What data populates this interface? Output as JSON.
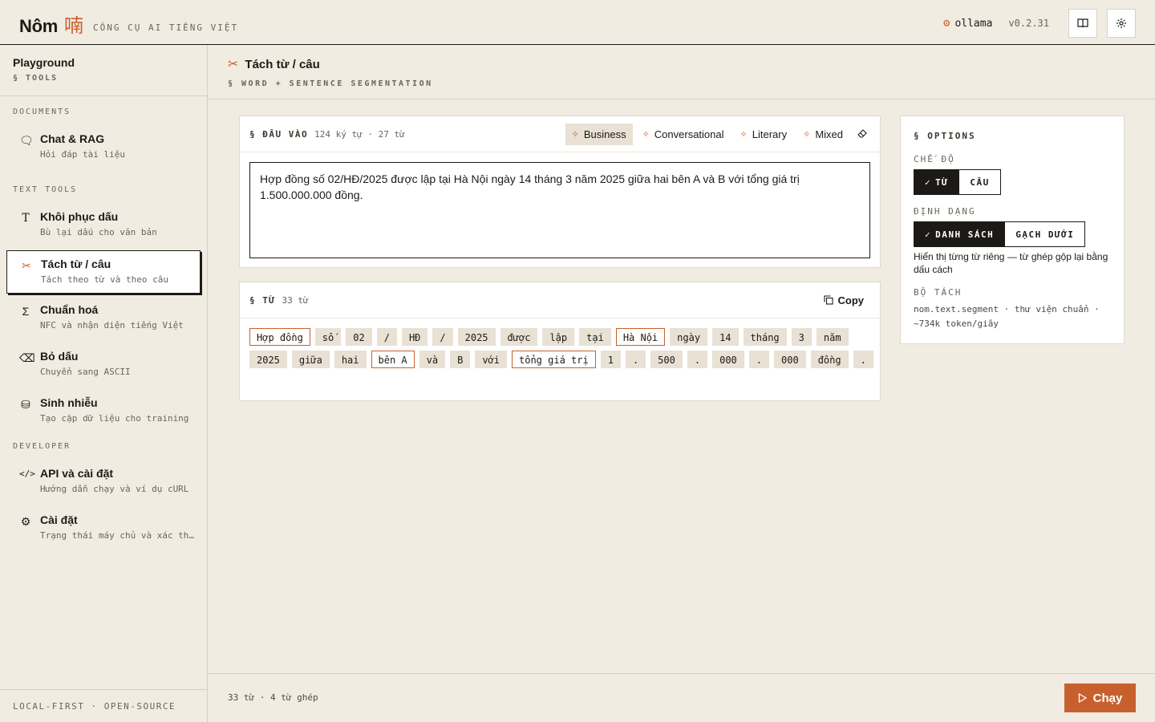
{
  "header": {
    "brand_name": "Nôm",
    "brand_glyph": "喃",
    "tagline": "CÔNG CỤ AI TIẾNG VIỆT",
    "model": "ollama",
    "version": "v0.2.31"
  },
  "sidebar": {
    "title": "Playground",
    "subtitle": "§ TOOLS",
    "sections": {
      "documents": "DOCUMENTS",
      "text_tools": "TEXT TOOLS",
      "developer": "DEVELOPER"
    },
    "items": [
      {
        "label": "Chat & RAG",
        "desc": "Hỏi đáp tài liệu",
        "icon": "chat-icon"
      },
      {
        "label": "Khôi phục dấu",
        "desc": "Bù lại dấu cho văn bản",
        "icon": "text-icon"
      },
      {
        "label": "Tách từ / câu",
        "desc": "Tách theo từ và theo câu",
        "icon": "scissors-icon"
      },
      {
        "label": "Chuẩn hoá",
        "desc": "NFC và nhận diện tiếng Việt",
        "icon": "sigma-icon"
      },
      {
        "label": "Bỏ dấu",
        "desc": "Chuyển sang ASCII",
        "icon": "eraser-icon"
      },
      {
        "label": "Sinh nhiễu",
        "desc": "Tạo cặp dữ liệu cho training",
        "icon": "database-icon"
      },
      {
        "label": "API và cài đặt",
        "desc": "Hướng dẫn chạy và ví dụ cURL",
        "icon": "code-icon"
      },
      {
        "label": "Cài đặt",
        "desc": "Trạng thái máy chủ và xác thực",
        "icon": "gear-icon"
      }
    ],
    "footer": "LOCAL-FIRST · OPEN-SOURCE"
  },
  "page": {
    "title": "Tách từ / câu",
    "subtitle": "§ WORD + SENTENCE SEGMENTATION"
  },
  "input_card": {
    "label": "§ ĐẦU VÀO",
    "meta": "124 ký tự · 27 từ",
    "presets": [
      "Business",
      "Conversational",
      "Literary",
      "Mixed"
    ],
    "active_preset": "Business",
    "text": "Hợp đồng số 02/HĐ/2025 được lập tại Hà Nội ngày 14 tháng 3 năm 2025 giữa hai bên A và B với tổng giá trị 1.500.000.000 đồng."
  },
  "output_card": {
    "label": "§ TỪ",
    "meta": "33 từ",
    "copy_label": "Copy",
    "tokens": [
      {
        "text": "Hợp đồng",
        "compound": true
      },
      {
        "text": "số",
        "compound": false
      },
      {
        "text": "02",
        "compound": false
      },
      {
        "text": "/",
        "compound": false
      },
      {
        "text": "HĐ",
        "compound": false
      },
      {
        "text": "/",
        "compound": false
      },
      {
        "text": "2025",
        "compound": false
      },
      {
        "text": "được",
        "compound": false
      },
      {
        "text": "lập",
        "compound": false
      },
      {
        "text": "tại",
        "compound": false
      },
      {
        "text": "Hà Nội",
        "compound": true
      },
      {
        "text": "ngày",
        "compound": false
      },
      {
        "text": "14",
        "compound": false
      },
      {
        "text": "tháng",
        "compound": false
      },
      {
        "text": "3",
        "compound": false
      },
      {
        "text": "năm",
        "compound": false
      },
      {
        "text": "2025",
        "compound": false
      },
      {
        "text": "giữa",
        "compound": false
      },
      {
        "text": "hai",
        "compound": false
      },
      {
        "text": "bên A",
        "compound": true
      },
      {
        "text": "và",
        "compound": false
      },
      {
        "text": "B",
        "compound": false
      },
      {
        "text": "với",
        "compound": false
      },
      {
        "text": "tổng giá trị",
        "compound": true
      },
      {
        "text": "1",
        "compound": false
      },
      {
        "text": ".",
        "compound": false
      },
      {
        "text": "500",
        "compound": false
      },
      {
        "text": ".",
        "compound": false
      },
      {
        "text": "000",
        "compound": false
      },
      {
        "text": ".",
        "compound": false
      },
      {
        "text": "000",
        "compound": false
      },
      {
        "text": "đồng",
        "compound": false
      },
      {
        "text": ".",
        "compound": false
      }
    ]
  },
  "options": {
    "title": "§ OPTIONS",
    "mode_label": "CHẾ ĐỘ",
    "mode_options": [
      "TỪ",
      "CÂU"
    ],
    "mode_selected": "TỪ",
    "format_label": "ĐỊNH DẠNG",
    "format_options": [
      "DANH SÁCH",
      "GẠCH DƯỚI"
    ],
    "format_selected": "DANH SÁCH",
    "format_help": "Hiển thị từng từ riêng — từ ghép gộp lại bằng dấu cách",
    "splitter_label": "BỘ TÁCH",
    "splitter_info": "nom.text.segment · thư viện chuẩn · ~734k token/giây"
  },
  "footer": {
    "stats": "33 từ · 4 từ ghép",
    "run_label": "Chạy"
  },
  "colors": {
    "accent": "#c8602e",
    "background": "#f1ece2",
    "ink": "#1c1a16"
  }
}
